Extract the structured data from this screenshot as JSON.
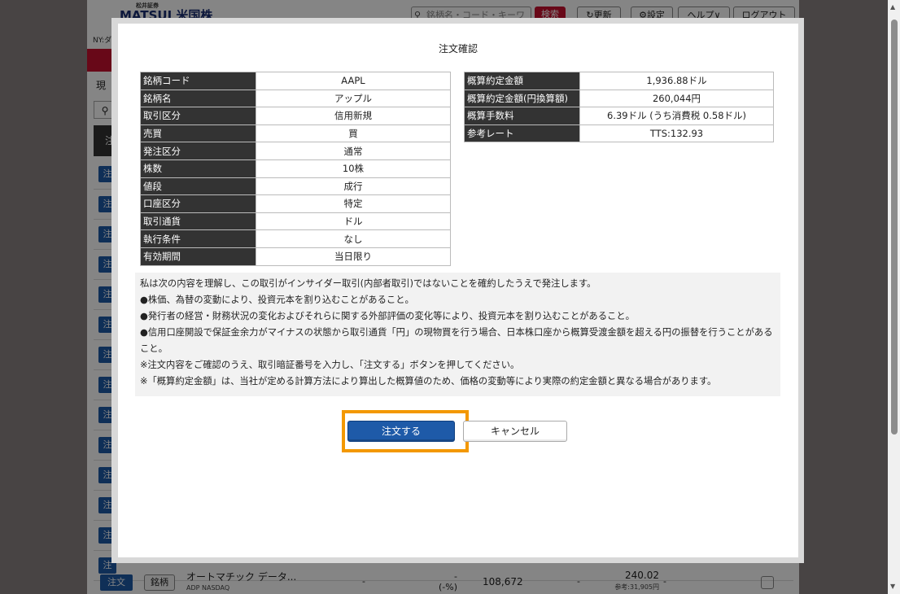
{
  "background": {
    "logo_small": "松井証券",
    "logo_main": "MATSUI 米国株",
    "search_placeholder": "銘柄名・コード・キーワード",
    "search_button": "検索",
    "refresh_button": "更新",
    "settings_button": "設定",
    "help_button": "ヘルプ",
    "logout_button": "ログアウト",
    "ny_label": "NY:ダ",
    "tab_label": "現",
    "order_short": "注",
    "last_row": {
      "order_button": "注文",
      "ticker_button": "銘柄",
      "name": "オートマチック データ...",
      "sub": "ADP  NASDAQ",
      "col1": "-",
      "col2_top": "-",
      "col2_bottom": "(-%)",
      "volume": "108,672",
      "col4": "-",
      "price": "240.02",
      "price_ref": "参考:31,905円",
      "col6": "-"
    }
  },
  "modal": {
    "title": "注文確認",
    "left_table": [
      {
        "label": "銘柄コード",
        "value": "AAPL"
      },
      {
        "label": "銘柄名",
        "value": "アップル"
      },
      {
        "label": "取引区分",
        "value": "信用新規"
      },
      {
        "label": "売買",
        "value": "買"
      },
      {
        "label": "発注区分",
        "value": "通常"
      },
      {
        "label": "株数",
        "value": "10株"
      },
      {
        "label": "値段",
        "value": "成行"
      },
      {
        "label": "口座区分",
        "value": "特定"
      },
      {
        "label": "取引通貨",
        "value": "ドル"
      },
      {
        "label": "執行条件",
        "value": "なし"
      },
      {
        "label": "有効期間",
        "value": "当日限り"
      }
    ],
    "right_table": [
      {
        "label": "概算約定金額",
        "value": "1,936.88ドル"
      },
      {
        "label": "概算約定金額(円換算額)",
        "value": "260,044円"
      },
      {
        "label": "概算手数料",
        "value": "6.39ドル (うち消費税 0.58ドル)"
      },
      {
        "label": "参考レート",
        "value": "TTS:132.93"
      }
    ],
    "notice": [
      "私は次の内容を理解し、この取引がインサイダー取引(内部者取引)ではないことを確約したうえで発注します。",
      "●株価、為替の変動により、投資元本を割り込むことがあること。",
      "●発行者の経営・財務状況の変化およびそれらに関する外部評価の変化等により、投資元本を割り込むことがあること。",
      "●信用口座開設で保証金余力がマイナスの状態から取引通貨「円」の現物買を行う場合、日本株口座から概算受渡金額を超える円の振替を行うことがあること。",
      "※注文内容をご確認のうえ、取引暗証番号を入力し、「注文する」ボタンを押してください。",
      "※「概算約定金額」は、当社が定める計算方法により算出した概算値のため、価格の変動等により実際の約定金額と異なる場合があります。"
    ],
    "order_button": "注文する",
    "cancel_button": "キャンセル"
  }
}
